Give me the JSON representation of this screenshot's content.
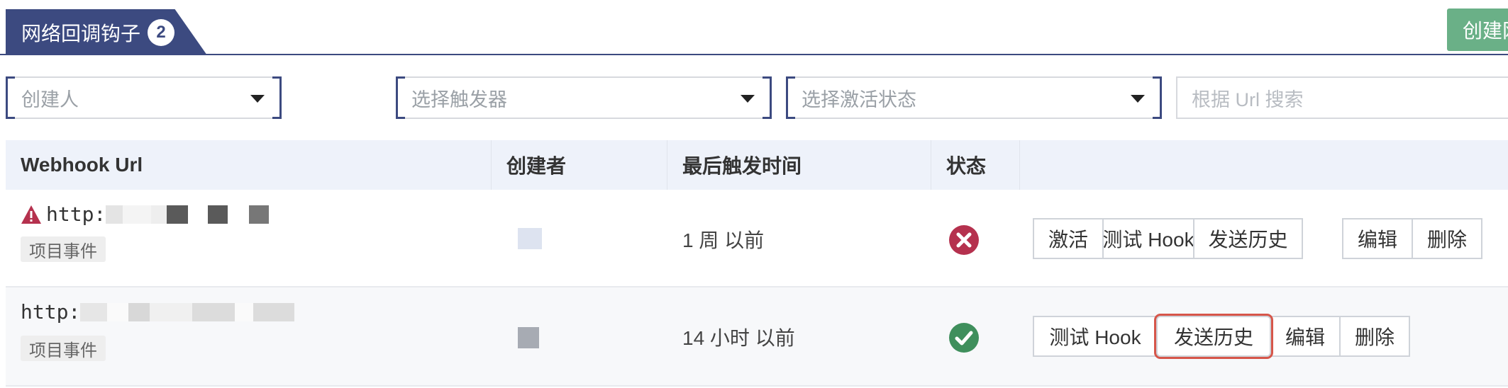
{
  "tabs": {
    "label": "网络回调钩子",
    "count": "2"
  },
  "create_button": "创建网",
  "filters": {
    "creator_placeholder": "创建人",
    "trigger_placeholder": "选择触发器",
    "status_placeholder": "选择激活状态",
    "search_placeholder": "根据 Url 搜索"
  },
  "table": {
    "headers": {
      "url": "Webhook Url",
      "creator": "创建者",
      "last_triggered": "最后触发时间",
      "status": "状态"
    },
    "rows": [
      {
        "url": "http:",
        "tag": "项目事件",
        "last_triggered": "1 周 以前",
        "status": "inactive",
        "warning": true,
        "actions": [
          "激活",
          "测试 Hook",
          "发送历史"
        ],
        "actions2": [
          "编辑",
          "删除"
        ]
      },
      {
        "url": "http:",
        "tag": "项目事件",
        "last_triggered": "14 小时 以前",
        "status": "active",
        "warning": false,
        "actions": [
          "测试 Hook"
        ],
        "highlight": "发送历史",
        "actions2": [
          "编辑",
          "删除"
        ]
      }
    ]
  },
  "colors": {
    "primary": "#3c4a80",
    "success": "#3f8f5c",
    "danger": "#b5314e",
    "create": "#6ab087",
    "highlight": "#d6564a"
  },
  "icons": {
    "row1_status": "x-circle-icon",
    "row2_status": "check-circle-icon",
    "row1_warning": "warning-triangle-icon"
  }
}
